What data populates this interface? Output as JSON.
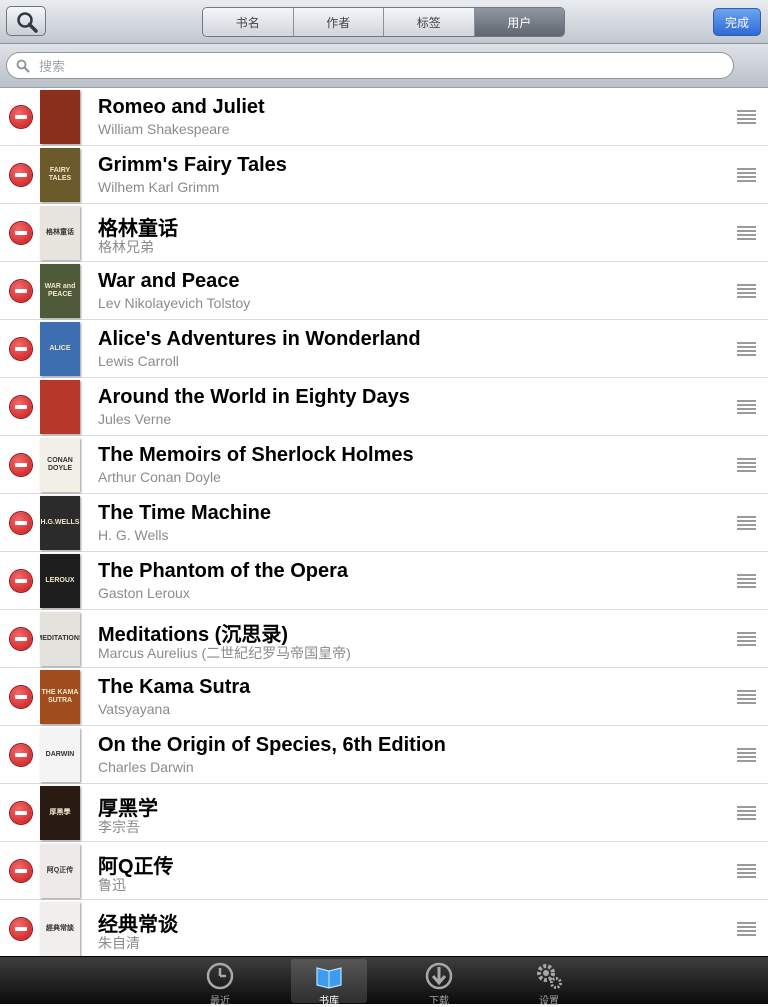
{
  "toolbar": {
    "segments": [
      "书名",
      "作者",
      "标签",
      "用户"
    ],
    "active_segment": "用户",
    "done_label": "完成"
  },
  "search": {
    "placeholder": "搜索",
    "value": ""
  },
  "books": [
    {
      "title": "Romeo and Juliet",
      "author": "William Shakespeare",
      "cover_color": "#8a2f1c"
    },
    {
      "title": "Grimm's Fairy Tales",
      "author": "Wilhem Karl Grimm",
      "cover_color": "#6b5a2c",
      "cover_text": "FAIRY TALES"
    },
    {
      "title": "格林童话",
      "author": "格林兄弟",
      "cover_color": "#e8e4de",
      "cover_text": "格林童话"
    },
    {
      "title": "War and Peace",
      "author": "Lev Nikolayevich Tolstoy",
      "cover_color": "#4f5a3a",
      "cover_text": "WAR and PEACE"
    },
    {
      "title": "Alice's Adventures in Wonderland",
      "author": "Lewis Carroll",
      "cover_color": "#3d6fb0",
      "cover_text": "ALICE"
    },
    {
      "title": "Around the World in Eighty Days",
      "author": "Jules Verne",
      "cover_color": "#b5382a"
    },
    {
      "title": "The Memoirs of Sherlock Holmes",
      "author": "Arthur Conan Doyle",
      "cover_color": "#f2efe6",
      "cover_text": "CONAN DOYLE"
    },
    {
      "title": "The Time Machine",
      "author": "H. G. Wells",
      "cover_color": "#2b2b2b",
      "cover_text": "H.G.WELLS"
    },
    {
      "title": "The Phantom of the Opera",
      "author": "Gaston Leroux",
      "cover_color": "#1e1e1e",
      "cover_text": "LEROUX"
    },
    {
      "title": "Meditations (沉思录)",
      "author": "Marcus Aurelius (二世紀纪罗马帝国皇帝)",
      "cover_color": "#e4e2dc",
      "cover_text": "MEDITATIONS"
    },
    {
      "title": "The Kama Sutra",
      "author": "Vatsyayana",
      "cover_color": "#a04e1e",
      "cover_text": "THE KAMA SUTRA"
    },
    {
      "title": "On the Origin of Species, 6th Edition",
      "author": "Charles Darwin",
      "cover_color": "#f4f4f4",
      "cover_text": "DARWIN"
    },
    {
      "title": "厚黑学",
      "author": "李宗吾",
      "cover_color": "#2a1a14",
      "cover_text": "厚黑學"
    },
    {
      "title": "阿Q正传",
      "author": "鲁迅",
      "cover_color": "#efeaea",
      "cover_text": "阿Q正传"
    },
    {
      "title": "经典常谈",
      "author": "朱自清",
      "cover_color": "#f1f0ee",
      "cover_text": "經典常談"
    }
  ],
  "tabs": [
    {
      "label": "最近",
      "icon": "clock-icon"
    },
    {
      "label": "书库",
      "icon": "open-book-icon"
    },
    {
      "label": "下载",
      "icon": "download-icon"
    },
    {
      "label": "设置",
      "icon": "gears-icon"
    }
  ],
  "active_tab": "书库",
  "colors": {
    "accent": "#2e6ad8",
    "delete": "#c9171b",
    "author_text": "#8b8b8b"
  }
}
